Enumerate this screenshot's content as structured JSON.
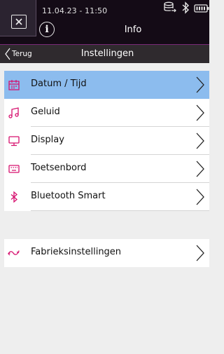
{
  "status_bar": {
    "datetime": "11.04.23 - 11:50",
    "icons": [
      "database-sync-icon",
      "bluetooth-icon",
      "battery-icon"
    ]
  },
  "header": {
    "close_icon": "close-icon",
    "info_icon": "info-icon",
    "info_glyph": "i",
    "title": "Info"
  },
  "nav": {
    "back_label": "Terug",
    "title": "Instellingen"
  },
  "settings": {
    "items": [
      {
        "label": "Datum / Tijd",
        "icon": "calendar-icon",
        "selected": true
      },
      {
        "label": "Geluid",
        "icon": "music-note-icon",
        "selected": false
      },
      {
        "label": "Display",
        "icon": "monitor-icon",
        "selected": false
      },
      {
        "label": "Toetsenbord",
        "icon": "keyboard-icon",
        "selected": false
      },
      {
        "label": "Bluetooth Smart",
        "icon": "bluetooth-icon",
        "selected": false
      }
    ]
  },
  "factory": {
    "label": "Fabrieksinstellingen",
    "icon": "factory-reset-icon"
  },
  "colors": {
    "header_bg": "#140b16",
    "nav_bg": "#2f2a2e",
    "accent_line": "#7a2a78",
    "selected_bg": "#8cbcee",
    "icon_accent": "#d6106e"
  }
}
